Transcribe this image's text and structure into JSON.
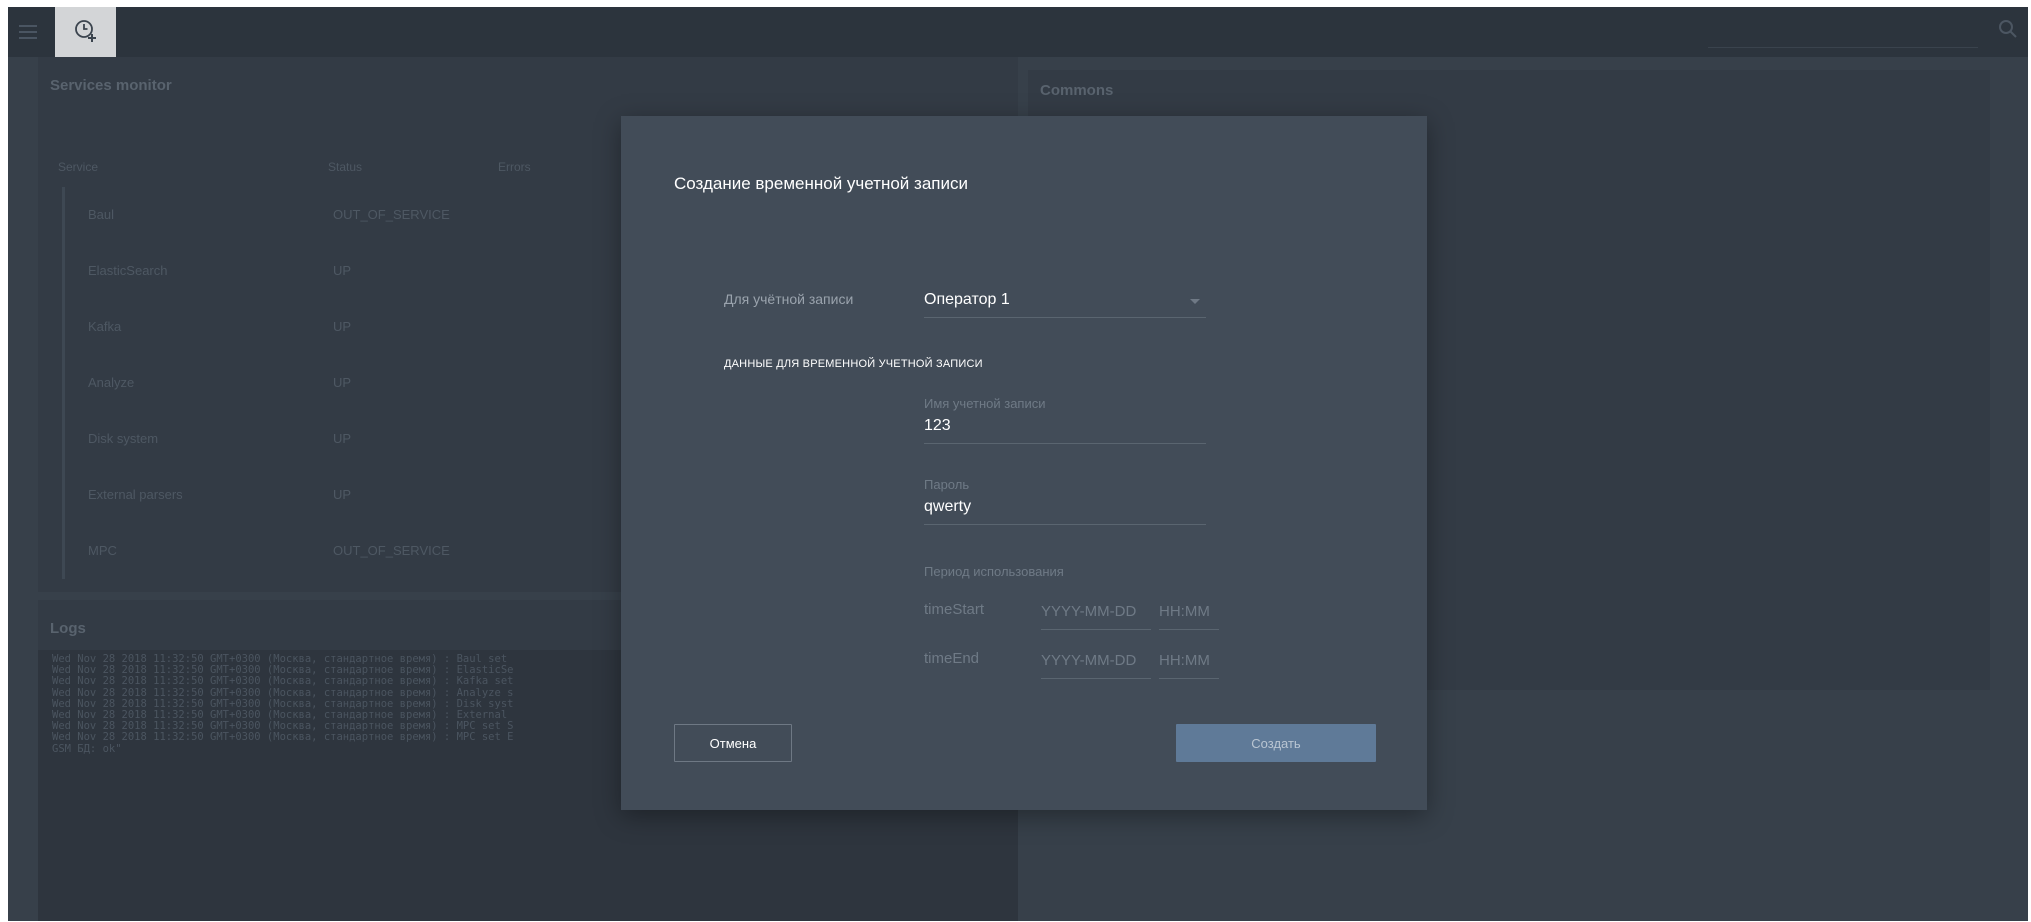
{
  "header": {
    "menu_icon": "hamburger-icon",
    "add_icon": "clock-plus-icon",
    "search_icon": "search-icon"
  },
  "services": {
    "title": "Services monitor",
    "columns": [
      "Service",
      "Status",
      "Errors"
    ],
    "rows": [
      {
        "name": "Baul",
        "status": "OUT_OF_SERVICE"
      },
      {
        "name": "ElasticSearch",
        "status": "UP"
      },
      {
        "name": "Kafka",
        "status": "UP"
      },
      {
        "name": "Analyze",
        "status": "UP"
      },
      {
        "name": "Disk system",
        "status": "UP"
      },
      {
        "name": "External parsers",
        "status": "UP"
      },
      {
        "name": "MPC",
        "status": "OUT_OF_SERVICE"
      }
    ]
  },
  "commons": {
    "title": "Commons"
  },
  "logs": {
    "title": "Logs",
    "lines": [
      "Wed Nov 28 2018 11:32:50 GMT+0300 (Москва, стандартное время) : Baul set",
      "Wed Nov 28 2018 11:32:50 GMT+0300 (Москва, стандартное время) : ElasticSe",
      "Wed Nov 28 2018 11:32:50 GMT+0300 (Москва, стандартное время) : Kafka set",
      "Wed Nov 28 2018 11:32:50 GMT+0300 (Москва, стандартное время) : Analyze s",
      "Wed Nov 28 2018 11:32:50 GMT+0300 (Москва, стандартное время) : Disk syst",
      "Wed Nov 28 2018 11:32:50 GMT+0300 (Москва, стандартное время) : External",
      "Wed Nov 28 2018 11:32:50 GMT+0300 (Москва, стандартное время) : MPC set S",
      "Wed Nov 28 2018 11:32:50 GMT+0300 (Москва, стандартное время) : MPC set E",
      "GSM БД: ok\""
    ]
  },
  "modal": {
    "title": "Создание временной учетной записи",
    "account_label": "Для учётной записи",
    "account_value": "Оператор 1",
    "section_title": "ДАННЫЕ ДЛЯ ВРЕМЕННОЙ УЧЕТНОЙ ЗАПИСИ",
    "username_label": "Имя учетной записи",
    "username_value": "123",
    "password_label": "Пароль",
    "password_value": "qwerty",
    "period_label": "Период использования",
    "time_start_label": "timeStart",
    "time_end_label": "timeEnd",
    "date_placeholder": "YYYY-MM-DD",
    "time_placeholder": "HH:MM",
    "cancel_label": "Отмена",
    "create_label": "Создать"
  }
}
